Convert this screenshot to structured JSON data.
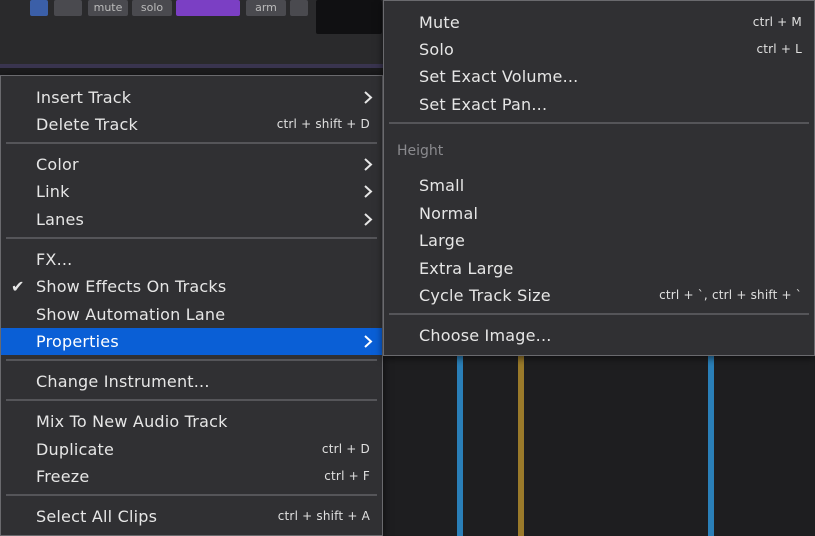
{
  "toolbar": {
    "mute_label": "mute",
    "solo_label": "solo",
    "arm_label": "arm"
  },
  "left_menu": {
    "insert_track": "Insert Track",
    "delete_track": "Delete Track",
    "delete_track_shortcut": "ctrl + shift + D",
    "color": "Color",
    "link": "Link",
    "lanes": "Lanes",
    "fx": "FX...",
    "show_effects": "Show Effects On Tracks",
    "show_effects_checked": true,
    "show_automation": "Show Automation Lane",
    "properties": "Properties",
    "change_instrument": "Change Instrument...",
    "mix_to_new": "Mix To New Audio Track",
    "duplicate": "Duplicate",
    "duplicate_shortcut": "ctrl + D",
    "freeze": "Freeze",
    "freeze_shortcut": "ctrl + F",
    "select_all_clips": "Select All Clips",
    "select_all_clips_shortcut": "ctrl + shift + A",
    "check_glyph": "✔"
  },
  "right_menu": {
    "mute": "Mute",
    "mute_shortcut": "ctrl + M",
    "solo": "Solo",
    "solo_shortcut": "ctrl + L",
    "set_exact_volume": "Set Exact Volume...",
    "set_exact_pan": "Set Exact Pan...",
    "height_header": "Height",
    "small": "Small",
    "normal": "Normal",
    "large": "Large",
    "extra_large": "Extra Large",
    "cycle_track_size": "Cycle Track Size",
    "cycle_track_size_shortcut": "ctrl + `, ctrl + shift + `",
    "choose_image": "Choose Image..."
  },
  "colors": {
    "selection": "#0a5fd6",
    "menu_bg": "#303033",
    "track_blue": "#2a7fb8",
    "track_gold": "#9a7a2a",
    "arm_purple": "#7b3fc4"
  }
}
